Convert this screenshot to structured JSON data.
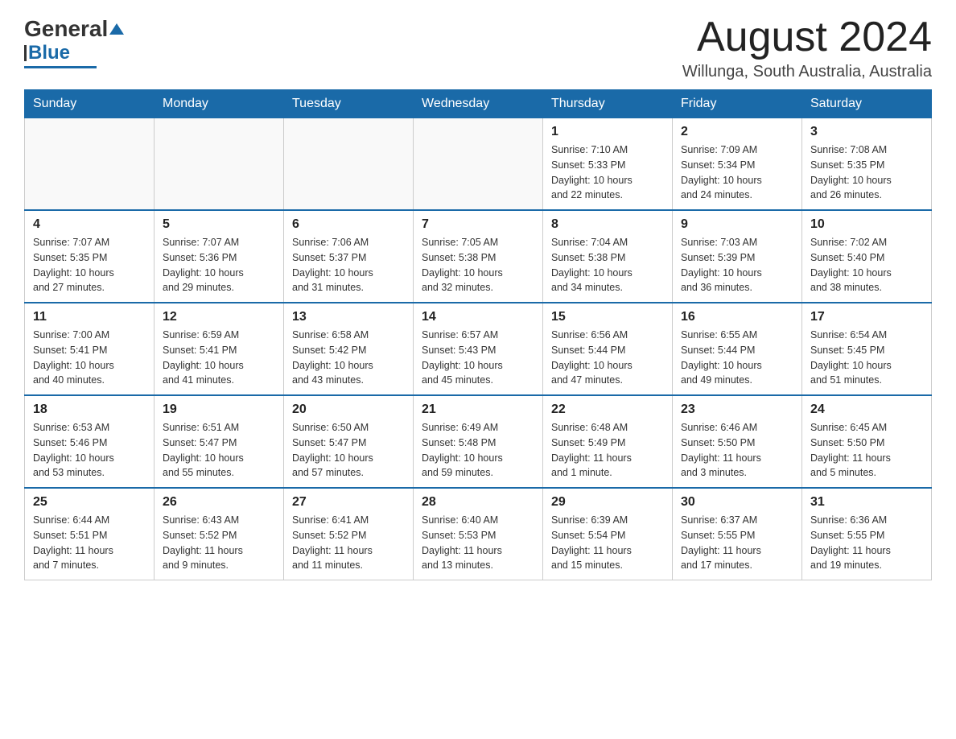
{
  "header": {
    "logo": {
      "general": "General",
      "blue": "Blue"
    },
    "title": "August 2024",
    "location": "Willunga, South Australia, Australia"
  },
  "days_of_week": [
    "Sunday",
    "Monday",
    "Tuesday",
    "Wednesday",
    "Thursday",
    "Friday",
    "Saturday"
  ],
  "weeks": [
    [
      {
        "day": "",
        "info": ""
      },
      {
        "day": "",
        "info": ""
      },
      {
        "day": "",
        "info": ""
      },
      {
        "day": "",
        "info": ""
      },
      {
        "day": "1",
        "info": "Sunrise: 7:10 AM\nSunset: 5:33 PM\nDaylight: 10 hours\nand 22 minutes."
      },
      {
        "day": "2",
        "info": "Sunrise: 7:09 AM\nSunset: 5:34 PM\nDaylight: 10 hours\nand 24 minutes."
      },
      {
        "day": "3",
        "info": "Sunrise: 7:08 AM\nSunset: 5:35 PM\nDaylight: 10 hours\nand 26 minutes."
      }
    ],
    [
      {
        "day": "4",
        "info": "Sunrise: 7:07 AM\nSunset: 5:35 PM\nDaylight: 10 hours\nand 27 minutes."
      },
      {
        "day": "5",
        "info": "Sunrise: 7:07 AM\nSunset: 5:36 PM\nDaylight: 10 hours\nand 29 minutes."
      },
      {
        "day": "6",
        "info": "Sunrise: 7:06 AM\nSunset: 5:37 PM\nDaylight: 10 hours\nand 31 minutes."
      },
      {
        "day": "7",
        "info": "Sunrise: 7:05 AM\nSunset: 5:38 PM\nDaylight: 10 hours\nand 32 minutes."
      },
      {
        "day": "8",
        "info": "Sunrise: 7:04 AM\nSunset: 5:38 PM\nDaylight: 10 hours\nand 34 minutes."
      },
      {
        "day": "9",
        "info": "Sunrise: 7:03 AM\nSunset: 5:39 PM\nDaylight: 10 hours\nand 36 minutes."
      },
      {
        "day": "10",
        "info": "Sunrise: 7:02 AM\nSunset: 5:40 PM\nDaylight: 10 hours\nand 38 minutes."
      }
    ],
    [
      {
        "day": "11",
        "info": "Sunrise: 7:00 AM\nSunset: 5:41 PM\nDaylight: 10 hours\nand 40 minutes."
      },
      {
        "day": "12",
        "info": "Sunrise: 6:59 AM\nSunset: 5:41 PM\nDaylight: 10 hours\nand 41 minutes."
      },
      {
        "day": "13",
        "info": "Sunrise: 6:58 AM\nSunset: 5:42 PM\nDaylight: 10 hours\nand 43 minutes."
      },
      {
        "day": "14",
        "info": "Sunrise: 6:57 AM\nSunset: 5:43 PM\nDaylight: 10 hours\nand 45 minutes."
      },
      {
        "day": "15",
        "info": "Sunrise: 6:56 AM\nSunset: 5:44 PM\nDaylight: 10 hours\nand 47 minutes."
      },
      {
        "day": "16",
        "info": "Sunrise: 6:55 AM\nSunset: 5:44 PM\nDaylight: 10 hours\nand 49 minutes."
      },
      {
        "day": "17",
        "info": "Sunrise: 6:54 AM\nSunset: 5:45 PM\nDaylight: 10 hours\nand 51 minutes."
      }
    ],
    [
      {
        "day": "18",
        "info": "Sunrise: 6:53 AM\nSunset: 5:46 PM\nDaylight: 10 hours\nand 53 minutes."
      },
      {
        "day": "19",
        "info": "Sunrise: 6:51 AM\nSunset: 5:47 PM\nDaylight: 10 hours\nand 55 minutes."
      },
      {
        "day": "20",
        "info": "Sunrise: 6:50 AM\nSunset: 5:47 PM\nDaylight: 10 hours\nand 57 minutes."
      },
      {
        "day": "21",
        "info": "Sunrise: 6:49 AM\nSunset: 5:48 PM\nDaylight: 10 hours\nand 59 minutes."
      },
      {
        "day": "22",
        "info": "Sunrise: 6:48 AM\nSunset: 5:49 PM\nDaylight: 11 hours\nand 1 minute."
      },
      {
        "day": "23",
        "info": "Sunrise: 6:46 AM\nSunset: 5:50 PM\nDaylight: 11 hours\nand 3 minutes."
      },
      {
        "day": "24",
        "info": "Sunrise: 6:45 AM\nSunset: 5:50 PM\nDaylight: 11 hours\nand 5 minutes."
      }
    ],
    [
      {
        "day": "25",
        "info": "Sunrise: 6:44 AM\nSunset: 5:51 PM\nDaylight: 11 hours\nand 7 minutes."
      },
      {
        "day": "26",
        "info": "Sunrise: 6:43 AM\nSunset: 5:52 PM\nDaylight: 11 hours\nand 9 minutes."
      },
      {
        "day": "27",
        "info": "Sunrise: 6:41 AM\nSunset: 5:52 PM\nDaylight: 11 hours\nand 11 minutes."
      },
      {
        "day": "28",
        "info": "Sunrise: 6:40 AM\nSunset: 5:53 PM\nDaylight: 11 hours\nand 13 minutes."
      },
      {
        "day": "29",
        "info": "Sunrise: 6:39 AM\nSunset: 5:54 PM\nDaylight: 11 hours\nand 15 minutes."
      },
      {
        "day": "30",
        "info": "Sunrise: 6:37 AM\nSunset: 5:55 PM\nDaylight: 11 hours\nand 17 minutes."
      },
      {
        "day": "31",
        "info": "Sunrise: 6:36 AM\nSunset: 5:55 PM\nDaylight: 11 hours\nand 19 minutes."
      }
    ]
  ]
}
